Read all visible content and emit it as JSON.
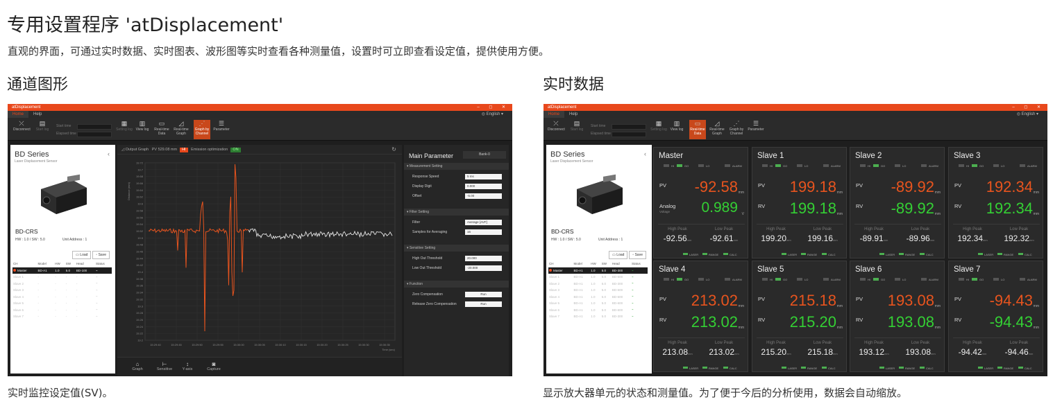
{
  "page": {
    "title": "专用设置程序 'atDisplacement'",
    "subtitle": "直观的界面，可通过实时数据、实时图表、波形图等实时查看各种测量值，设置时可立即查看设定值，提供使用方便。",
    "left": {
      "heading": "通道图形",
      "caption": "实时监控设定值(SV)。"
    },
    "right": {
      "heading": "实时数据",
      "caption": "显示放大器单元的状态和测量值。为了便于今后的分析使用，数据会自动缩放。"
    }
  },
  "app": {
    "window_title": "atDisplacement",
    "menu": [
      "Home",
      "Help"
    ],
    "language": "English",
    "ribbon": {
      "disconnect": "Disconnect",
      "start_log": "Start log",
      "start_time": "Start time",
      "elapsed_time": "Elapsed time",
      "setting_log": "Setting log",
      "view_log": "View log",
      "real_time_data": "Real-time Data",
      "real_time_graph": "Real-time Graph",
      "graph_by_channel": "Graph by Channel",
      "parameter": "Parameter"
    },
    "device": {
      "series": "BD Series",
      "series_sub": "Laser Displacement Sensor",
      "model": "BD-CRS",
      "hw_sw": "HW : 1.0 / SW : 5.0",
      "unit_address": "Unit Address : 1",
      "load": "Load",
      "save": "Save"
    },
    "channel_table": {
      "headers": [
        "CH",
        "Model",
        "HW",
        "SW",
        "Head",
        "Status"
      ],
      "left_rows": [
        [
          "Master",
          "BD-A1",
          "1.0",
          "5.0",
          "BD-100"
        ],
        [
          "Slave 1",
          "-",
          "-",
          "-",
          "-"
        ],
        [
          "Slave 2",
          "-",
          "-",
          "-",
          "-"
        ],
        [
          "Slave 3",
          "-",
          "-",
          "-",
          "-"
        ],
        [
          "Slave 4",
          "-",
          "-",
          "-",
          "-"
        ],
        [
          "Slave 5",
          "-",
          "-",
          "-",
          "-"
        ],
        [
          "Slave 6",
          "-",
          "-",
          "-",
          "-"
        ],
        [
          "Slave 7",
          "-",
          "-",
          "-",
          "-"
        ]
      ],
      "right_rows": [
        [
          "Master",
          "BD-A1",
          "1.0",
          "5.0",
          "BD-300"
        ],
        [
          "Slave 1",
          "BD-A1",
          "1.0",
          "5.0",
          "BD-600"
        ],
        [
          "Slave 2",
          "BD-A1",
          "1.0",
          "5.0",
          "BD-300"
        ],
        [
          "Slave 3",
          "BD-A1",
          "1.0",
          "5.0",
          "BD-600"
        ],
        [
          "Slave 4",
          "BD-A1",
          "1.0",
          "5.0",
          "BD-600"
        ],
        [
          "Slave 5",
          "BD-A1",
          "1.0",
          "5.0",
          "BD-600"
        ],
        [
          "Slave 6",
          "BD-A1",
          "1.0",
          "5.0",
          "BD-600"
        ],
        [
          "Slave 7",
          "BD-A1",
          "1.0",
          "5.0",
          "BD-300"
        ]
      ]
    },
    "graph": {
      "title": "Output Graph",
      "pv_label": "PV",
      "pv_value": "529.08 mm",
      "pv_tag": "HI",
      "emission": "Emission optimization",
      "emission_tag": "ON",
      "y_axis_label": "Distance (mm)",
      "x_axis_label": "Time (sec)",
      "y_ticks": [
        "19.72",
        "19.7",
        "19.68",
        "19.66",
        "19.64",
        "19.62",
        "19.6",
        "19.58",
        "19.56",
        "19.54",
        "19.52",
        "19.5",
        "19.48",
        "19.46",
        "19.44",
        "19.42",
        "19.4",
        "19.38",
        "19.36",
        "19.34",
        "19.32",
        "19.3",
        "19.28",
        "19.26",
        "19.24",
        "19.22",
        "19.2"
      ],
      "x_ticks": [
        "15:29:40",
        "15:29:45",
        "15:29:50",
        "15:29:55",
        "15:30:00",
        "15:30:05",
        "15:30:10",
        "15:30:15",
        "15:30:20",
        "15:30:25",
        "15:30:30",
        "15:30:35"
      ],
      "footer": [
        "Graph",
        "Sensitive",
        "Y-axis",
        "Capture"
      ]
    },
    "params": {
      "title": "Main Parameter",
      "bank": "Bank-0",
      "sections": [
        {
          "name": "Measurement Setting",
          "rows": [
            {
              "label": "Response Speed",
              "value": "5 ms"
            },
            {
              "label": "Display Digit",
              "value": "0.000"
            },
            {
              "label": "Offset",
              "value": "-5.00"
            }
          ]
        },
        {
          "name": "Filter Setting",
          "rows": [
            {
              "label": "Filter",
              "value": "Average [AVF]"
            },
            {
              "label": "Samples for Averaging",
              "value": "16"
            }
          ]
        },
        {
          "name": "Sensitive Setting",
          "rows": [
            {
              "label": "High Out Threshold",
              "value": "20.000"
            },
            {
              "label": "Low Out Threshold",
              "value": "-20.000"
            }
          ]
        },
        {
          "name": "Function",
          "rows": [
            {
              "label": "Zero Compensation",
              "value": "Run"
            },
            {
              "label": "Release Zero Compensation",
              "value": "Run"
            }
          ]
        }
      ]
    },
    "cards": [
      {
        "name": "Master",
        "l1": "PV",
        "v1": "-92.58",
        "u1": "mm",
        "l2": "Analog",
        "l2sub": "Voltage",
        "v2": "0.989",
        "u2": "V",
        "hp": "-92.56",
        "lp": "-92.61"
      },
      {
        "name": "Slave 1",
        "l1": "PV",
        "v1": "199.18",
        "u1": "mm",
        "l2": "RV",
        "l2sub": "",
        "v2": "199.18",
        "u2": "mm",
        "hp": "199.20",
        "lp": "199.16"
      },
      {
        "name": "Slave 2",
        "l1": "PV",
        "v1": "-89.92",
        "u1": "mm",
        "l2": "RV",
        "l2sub": "",
        "v2": "-89.92",
        "u2": "mm",
        "hp": "-89.91",
        "lp": "-89.96"
      },
      {
        "name": "Slave 3",
        "l1": "PV",
        "v1": "192.34",
        "u1": "mm",
        "l2": "RV",
        "l2sub": "",
        "v2": "192.34",
        "u2": "mm",
        "hp": "192.34",
        "lp": "192.32"
      },
      {
        "name": "Slave 4",
        "l1": "PV",
        "v1": "213.02",
        "u1": "mm",
        "l2": "RV",
        "l2sub": "",
        "v2": "213.02",
        "u2": "mm",
        "hp": "213.08",
        "lp": "213.02"
      },
      {
        "name": "Slave 5",
        "l1": "PV",
        "v1": "215.18",
        "u1": "mm",
        "l2": "RV",
        "l2sub": "",
        "v2": "215.20",
        "u2": "mm",
        "hp": "215.20",
        "lp": "215.18"
      },
      {
        "name": "Slave 6",
        "l1": "PV",
        "v1": "193.08",
        "u1": "mm",
        "l2": "RV",
        "l2sub": "",
        "v2": "193.08",
        "u2": "mm",
        "hp": "193.12",
        "lp": "193.08"
      },
      {
        "name": "Slave 7",
        "l1": "PV",
        "v1": "-94.43",
        "u1": "mm",
        "l2": "RV",
        "l2sub": "",
        "v2": "-94.43",
        "u2": "mm",
        "hp": "-94.42",
        "lp": "-94.46"
      }
    ],
    "card_labels": {
      "hi": "HI",
      "go": "GO",
      "lo": "LO",
      "alarm": "ALARM",
      "high_peak": "High Peak",
      "low_peak": "Low Peak",
      "laser": "LASER",
      "range": "RANGE",
      "calc": "CALC"
    },
    "colors": {
      "accent": "#e8481c",
      "value_red": "#e8541e",
      "value_green": "#34d034"
    }
  }
}
